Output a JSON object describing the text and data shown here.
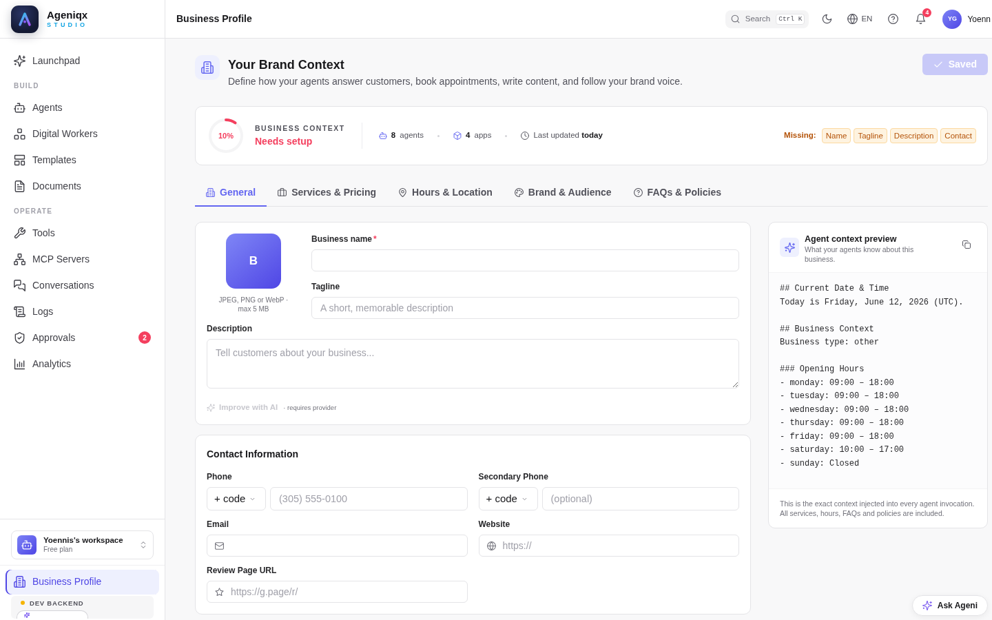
{
  "sidebar": {
    "brand": {
      "name": "Ageniqx",
      "subtitle": "STUDIO"
    },
    "groups": [
      {
        "items": [
          {
            "label": "Launchpad",
            "selected": false
          }
        ]
      },
      {
        "heading": "BUILD",
        "items": [
          {
            "label": "Agents",
            "selected": false
          },
          {
            "label": "Digital Workers",
            "selected": false
          },
          {
            "label": "Templates",
            "selected": false
          },
          {
            "label": "Documents",
            "selected": false
          }
        ]
      },
      {
        "heading": "OPERATE",
        "items": [
          {
            "label": "Tools",
            "selected": false
          },
          {
            "label": "MCP Servers",
            "selected": false
          },
          {
            "label": "Conversations",
            "selected": false
          },
          {
            "label": "Logs",
            "selected": false
          },
          {
            "label": "Approvals",
            "selected": false,
            "badge": "2"
          },
          {
            "label": "Analytics",
            "selected": false
          }
        ]
      }
    ],
    "workspace": {
      "name": "Yoennis's workspace",
      "plan": "Free plan"
    },
    "pinned": [
      {
        "label": "Business Profile",
        "selected": true
      }
    ],
    "backend": {
      "label": "DEV BACKEND"
    }
  },
  "topbar": {
    "title": "Business Profile",
    "search": {
      "label": "Search",
      "shortcut": "Ctrl K"
    },
    "language": "EN",
    "notifications": "4",
    "user": {
      "initials": "YG",
      "name": "Yoenn"
    }
  },
  "header": {
    "title": "Your Brand Context",
    "subtitle": "Define how your agents answer customers, book appointments, write content, and follow your brand voice.",
    "save_button": {
      "label": "Saved",
      "disabled": true
    }
  },
  "status": {
    "progress": {
      "level": 0.1,
      "reading": "10%"
    },
    "heading": "BUSINESS CONTEXT",
    "state": "Needs setup",
    "stats": [
      {
        "kind": "agents",
        "text": "**8** agents"
      },
      {
        "kind": "apps",
        "text": "**4** apps"
      },
      {
        "kind": "updated",
        "text": "Last updated **today**"
      }
    ],
    "missing": {
      "label": "Missing:",
      "items": [
        "Name",
        "Tagline",
        "Description",
        "Contact"
      ]
    }
  },
  "tabs": [
    {
      "label": "General",
      "selected": true
    },
    {
      "label": "Services & Pricing",
      "selected": false
    },
    {
      "label": "Hours & Location",
      "selected": false
    },
    {
      "label": "Brand & Audience",
      "selected": false
    },
    {
      "label": "FAQs & Policies",
      "selected": false
    }
  ],
  "general": {
    "logo": {
      "letter": "B",
      "hint": "JPEG, PNG or WebP · max 5 MB"
    },
    "fields": [
      {
        "label": "Business name",
        "required_mark": "*"
      },
      {
        "label": "Tagline",
        "placeholder": "A short, memorable description"
      }
    ],
    "description": {
      "label": "Description",
      "placeholder": "Tell customers about your business..."
    },
    "improve": {
      "label": "Improve with AI",
      "disabled": true,
      "note": "· requires provider"
    }
  },
  "contact": {
    "title": "Contact Information",
    "fields": [
      {
        "kind": "phone",
        "label": "Phone",
        "code": "+ code",
        "placeholder": "(305) 555-0100"
      },
      {
        "kind": "phone",
        "label": "Secondary Phone",
        "code": "+ code",
        "placeholder": "(optional)"
      },
      {
        "kind": "email",
        "label": "Email"
      },
      {
        "kind": "website",
        "label": "Website",
        "placeholder": "https://"
      },
      {
        "kind": "review",
        "label": "Review Page URL",
        "placeholder": "https://g.page/r/"
      }
    ]
  },
  "preview": {
    "title": "Agent context preview",
    "subtitle": "What your agents know about this business.",
    "blocks": [
      [
        "## Current Date & Time",
        "Today is Friday, June 12, 2026 (UTC)."
      ],
      [
        "## Business Context",
        "Business type: other"
      ],
      [
        "### Opening Hours",
        "- monday: 09:00 – 18:00",
        "- tuesday: 09:00 – 18:00",
        "- wednesday: 09:00 – 18:00",
        "- thursday: 09:00 – 18:00",
        "- friday: 09:00 – 18:00",
        "- saturday: 10:00 – 17:00",
        "- sunday: Closed"
      ]
    ],
    "footer": "This is the exact context injected into every agent invocation. All services, hours, FAQs and policies are included."
  },
  "assistant_button": {
    "label": "Ask Ageni"
  }
}
